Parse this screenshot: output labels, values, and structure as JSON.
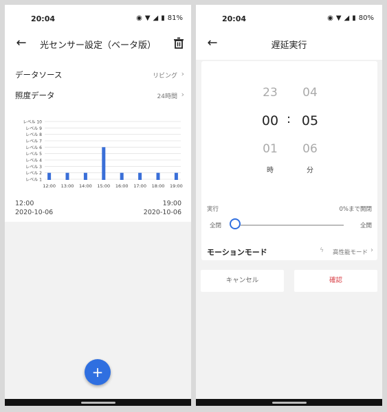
{
  "left": {
    "status": {
      "time": "20:04",
      "battery": "81%"
    },
    "title": "光センサー設定（ベータ版）",
    "rows": [
      {
        "label": "データソース",
        "value": "リビング"
      },
      {
        "label": "照度データ",
        "value": "24時間"
      }
    ],
    "footer": {
      "start_time": "12:00",
      "start_date": "2020-10-06",
      "end_time": "19:00",
      "end_date": "2020-10-06"
    },
    "fab_label": "+"
  },
  "right": {
    "status": {
      "time": "20:04",
      "battery": "80%"
    },
    "title": "遅延実行",
    "picker": {
      "hours_prev": "23",
      "hours": "00",
      "hours_next": "01",
      "minutes_prev": "04",
      "minutes": "05",
      "minutes_next": "06",
      "colon": ":",
      "hours_unit": "時",
      "minutes_unit": "分"
    },
    "execute_label": "実行",
    "open_status": "0%まで開閉",
    "slider_left": "全閉",
    "slider_right": "全開",
    "slider_value": 0,
    "motion_label": "モーションモード",
    "motion_value": "高性能モード",
    "cancel_label": "キャンセル",
    "confirm_label": "確認"
  },
  "chart_data": {
    "type": "bar",
    "categories": [
      "12:00",
      "",
      "13:00",
      "",
      "14:00",
      "",
      "15:00",
      "",
      "16:00",
      "",
      "17:00",
      "",
      "18:00",
      "",
      "19:00"
    ],
    "values": [
      2,
      null,
      2,
      null,
      2,
      null,
      6,
      null,
      2,
      null,
      2,
      null,
      2,
      null,
      2
    ],
    "y_tick_labels": [
      "レベル 1",
      "レベル 2",
      "レベル 3",
      "レベル 4",
      "レベル 5",
      "レベル 6",
      "レベル 7",
      "レベル 8",
      "レベル 9",
      "レベル 10"
    ],
    "ylim": [
      1,
      10
    ],
    "grid": true,
    "bar_color": "#3a6fd8"
  },
  "colors": {
    "accent": "#2f6fe0",
    "confirm": "#d9434a"
  }
}
